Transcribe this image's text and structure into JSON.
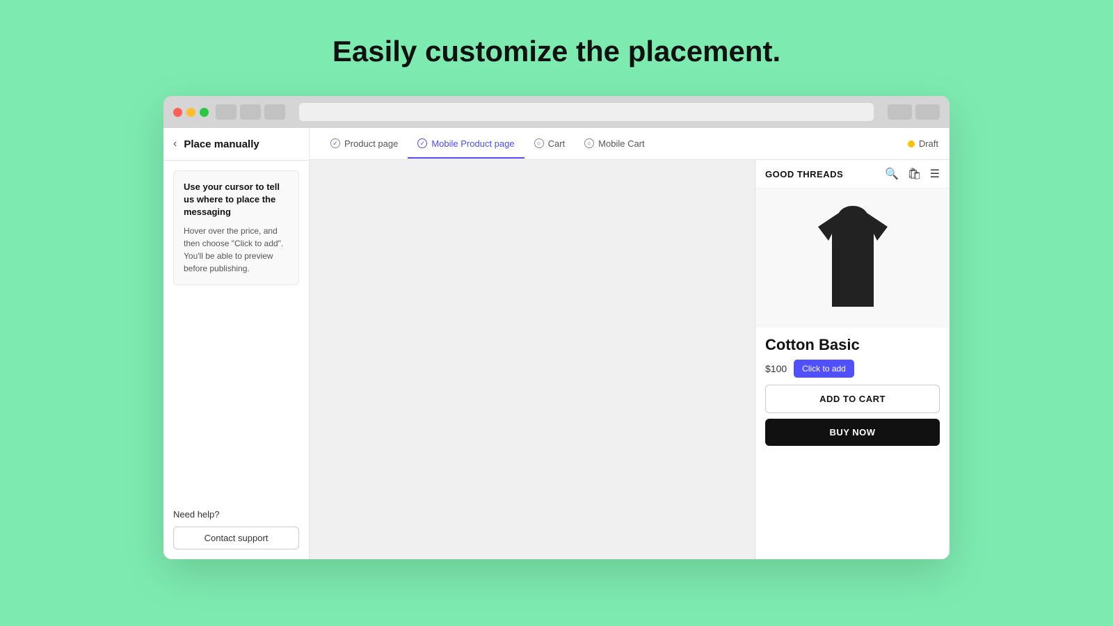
{
  "page": {
    "heading": "Easily customize the placement."
  },
  "browser": {
    "tabs": [
      {
        "id": "product-page",
        "label": "Product page",
        "active": false
      },
      {
        "id": "mobile-product-page",
        "label": "Mobile Product page",
        "active": true
      },
      {
        "id": "cart",
        "label": "Cart",
        "active": false
      },
      {
        "id": "mobile-cart",
        "label": "Mobile Cart",
        "active": false
      }
    ],
    "draft_label": "Draft"
  },
  "sidebar": {
    "back_label": "‹",
    "title": "Place manually",
    "info_title": "Use your cursor to tell us where to place the messaging",
    "info_text": "Hover over the price, and then choose \"Click to add\". You'll be able to preview before publishing.",
    "help_label": "Need help?",
    "contact_button": "Contact support"
  },
  "mobile_product": {
    "store_name": "GOOD THREADS",
    "product_name": "Cotton Basic",
    "price": "$100",
    "click_to_add_label": "Click to add",
    "add_to_cart_label": "ADD TO CART",
    "buy_now_label": "BUY NOW"
  }
}
